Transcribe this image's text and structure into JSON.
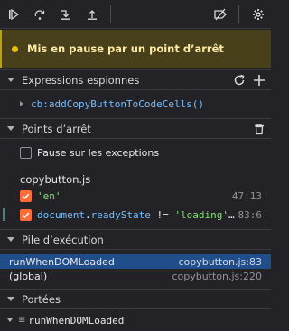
{
  "colors": {
    "background": "#232327",
    "banner_bg": "#47401b",
    "banner_text": "#ffe9a6",
    "checkbox_on": "#ff6c37",
    "selected_row": "#204e8a",
    "keyword": "#75bfff",
    "string": "#86de74"
  },
  "toolbar": {
    "buttons": [
      "resume-icon",
      "step-over-icon",
      "step-in-icon",
      "step-out-icon",
      "deactivate-breakpoints-icon",
      "settings-icon"
    ]
  },
  "banner": {
    "text": "Mis en pause par un point d’arrêt"
  },
  "watch": {
    "title": "Expressions espionnes",
    "item": "cb:addCopyButtonToCodeCells()"
  },
  "breakpoints": {
    "title": "Points d’arrêt",
    "pause_exceptions": "Pause sur les exceptions",
    "file": "copybutton.js",
    "items": [
      {
        "code_str": "'en'",
        "line": "47:13"
      },
      {
        "code_obj": "document",
        "code_dot": ".",
        "code_prop": "readyState",
        "code_op": " != ",
        "code_str": "'loading'",
        "code_ell": "…",
        "line": "83:6"
      }
    ]
  },
  "callstack": {
    "title": "Pile d’exécution",
    "frames": [
      {
        "fn": "runWhenDOMLoaded",
        "loc": "copybutton.js:83"
      },
      {
        "fn": "(global)",
        "loc": "copybutton.js:220"
      }
    ]
  },
  "scopes": {
    "title": "Portées",
    "item": "runWhenDOMLoaded"
  }
}
